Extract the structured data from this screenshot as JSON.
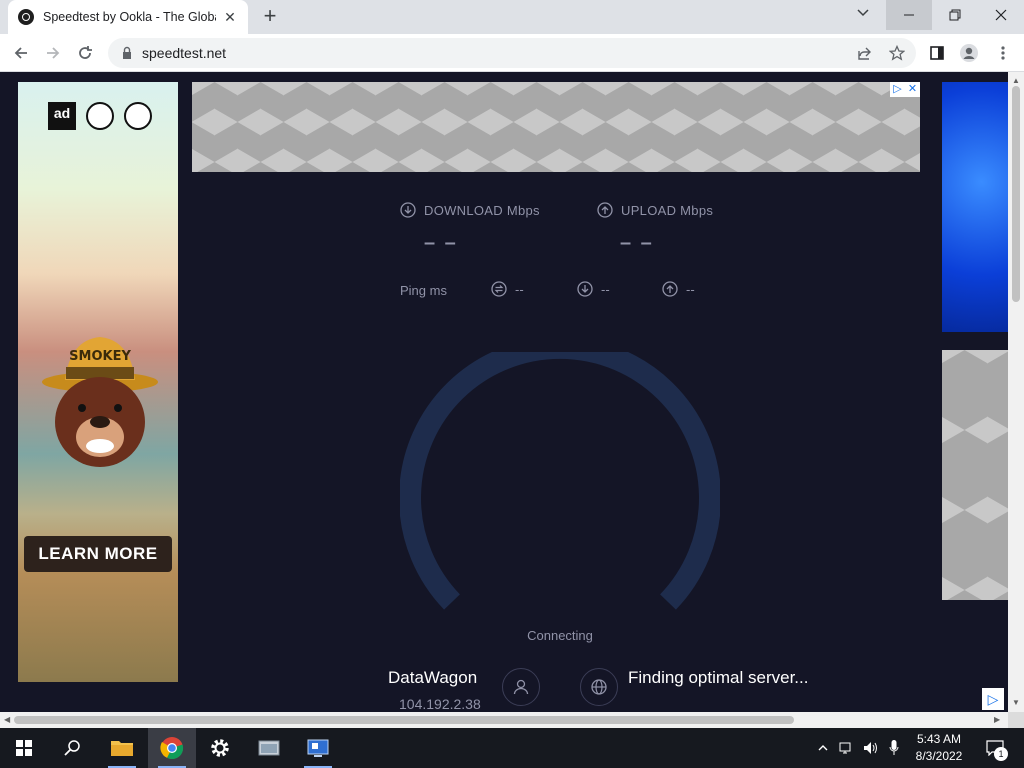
{
  "browser": {
    "tab_title": "Speedtest by Ookla - The Global Broadband Speed Test",
    "tab_close": "✕",
    "new_tab": "+",
    "url": "speedtest.net"
  },
  "ads": {
    "left_logo_text": "ad",
    "left_hat_text": "SMOKEY",
    "learn_more": "LEARN MORE"
  },
  "speedtest": {
    "download_label": "DOWNLOAD Mbps",
    "upload_label": "UPLOAD Mbps",
    "download_value": "– –",
    "upload_value": "– –",
    "ping_label": "Ping  ms",
    "ping_idle": "--",
    "ping_down": "--",
    "ping_up": "--",
    "status": "Connecting",
    "isp_name": "DataWagon",
    "isp_ip": "104.192.2.38",
    "server_text": "Finding optimal server..."
  },
  "colors": {
    "page_bg": "#141526",
    "gauge_track": "#1e2c4c",
    "text_muted": "#9193a8"
  },
  "taskbar": {
    "time": "5:43 AM",
    "date": "8/3/2022",
    "notification_count": "1"
  }
}
